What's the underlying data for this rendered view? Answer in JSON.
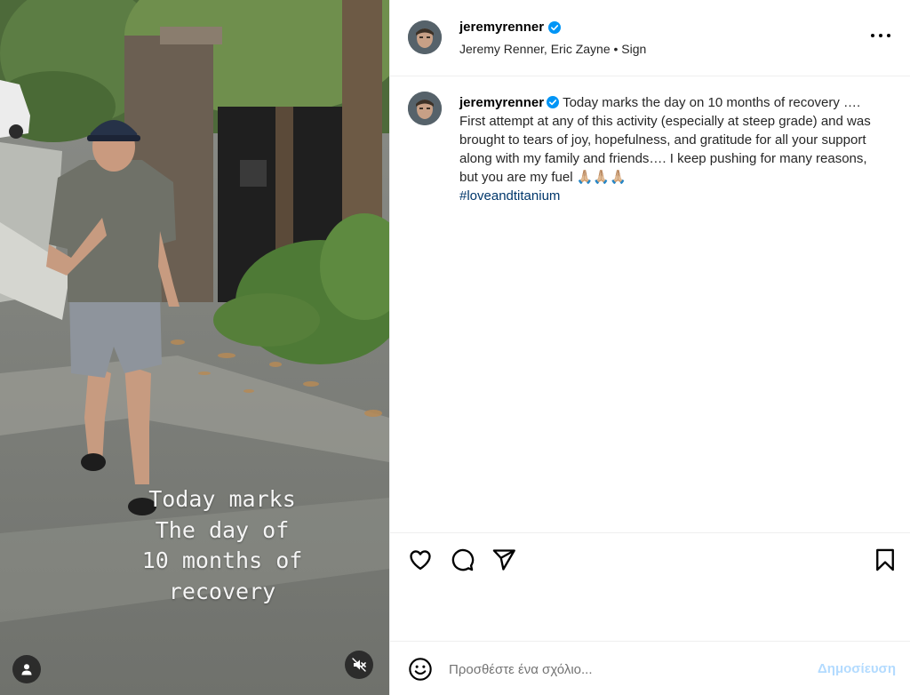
{
  "media": {
    "overlay_text": "Today marks\nThe day of\n10 months of\nrecovery"
  },
  "header": {
    "username": "jeremyrenner",
    "subtitle": "Jeremy Renner, Eric Zayne • Sign"
  },
  "caption": {
    "username": "jeremyrenner",
    "text": "Today marks the day on 10 months of recovery …. First attempt at any of this activity (especially at steep grade) and was brought to tears of joy, hopefulness, and gratitude for all your support along with my family and friends…. I keep pushing for many reasons, but you are my fuel 🙏🏼🙏🏼🙏🏼",
    "hashtag": "#loveandtitanium"
  },
  "comment_bar": {
    "placeholder": "Προσθέστε ένα σχόλιο...",
    "post_label": "Δημοσίευση"
  },
  "colors": {
    "verified": "#0095f6",
    "hashtag": "#00376b",
    "post_button_disabled": "#b3dbff"
  },
  "icons": {
    "verified": "verified-badge-icon",
    "more": "more-options-icon",
    "like": "heart-icon",
    "comment": "comment-bubble-icon",
    "share": "paper-plane-icon",
    "save": "bookmark-icon",
    "emoji": "smiley-icon",
    "user": "user-icon",
    "mute": "speaker-muted-icon"
  }
}
